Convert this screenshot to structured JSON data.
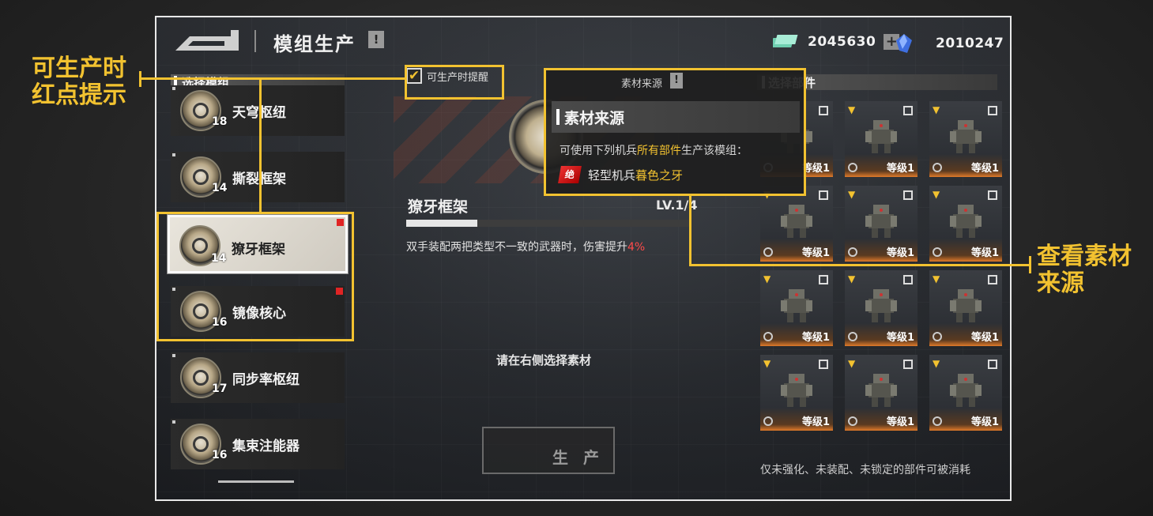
{
  "header": {
    "title": "模组生产",
    "title_alert": "!",
    "resources": [
      {
        "icon": "money-bundle-icon",
        "value": "2045630",
        "plus": "+"
      },
      {
        "icon": "blue-crystal-icon",
        "value": "2010247",
        "plus": "+"
      }
    ]
  },
  "left_panel": {
    "heading": "选择模组",
    "items": [
      {
        "name": "天穹枢纽",
        "level": "18",
        "red_dot": false,
        "selected": false
      },
      {
        "name": "撕裂框架",
        "level": "14",
        "red_dot": false,
        "selected": false
      },
      {
        "name": "獠牙框架",
        "level": "14",
        "red_dot": true,
        "selected": true
      },
      {
        "name": "镜像核心",
        "level": "16",
        "red_dot": true,
        "selected": false
      },
      {
        "name": "同步率枢纽",
        "level": "17",
        "red_dot": false,
        "selected": false
      },
      {
        "name": "集束注能器",
        "level": "16",
        "red_dot": false,
        "selected": false
      }
    ]
  },
  "reminder_checkbox": {
    "label": "可生产时提醒",
    "checked": true,
    "check_glyph": "✔"
  },
  "module_detail": {
    "name": "獠牙框架",
    "level_text": "LV.1/4",
    "level_progress": 0.25,
    "desc_prefix": "双手装配两把类型不一致的武器时，伤害提升",
    "desc_value": "4%",
    "prompt": "请在右侧选择素材",
    "produce_button": "生 产"
  },
  "material_popup": {
    "top_label": "素材来源",
    "top_alert": "!",
    "heading": "素材来源",
    "desc_prefix": "可使用下列机兵",
    "desc_highlight": "所有部件",
    "desc_suffix": "生产该模组：",
    "mech_badge": "绝",
    "mech_prefix": "轻型机兵",
    "mech_name": "暮色之牙"
  },
  "right_panel": {
    "heading": "选择部件",
    "level_label": "等级1",
    "parts_count": 12,
    "footer_note": "仅未强化、未装配、未锁定的部件可被消耗"
  },
  "annotations": {
    "left_line1": "可生产时",
    "left_line2": "红点提示",
    "right_line1": "查看素材",
    "right_line2": "来源"
  },
  "colors": {
    "accent": "#f2c230",
    "red_dot": "#e02424",
    "highlight_red": "#ff4a4a"
  }
}
